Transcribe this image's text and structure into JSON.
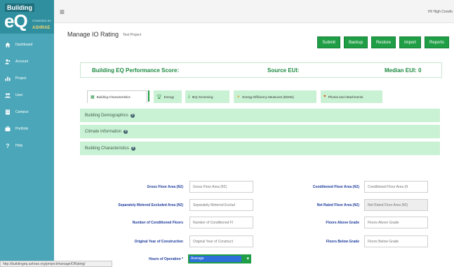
{
  "brand": {
    "top": "Building",
    "eq": "eQ",
    "sub": "POWERED BY",
    "org": "ASHRAE",
    "colors": {
      "sidebar": "#4aa6b8",
      "accent_green": "#1f9e45",
      "section_bg": "#c9f1d3"
    }
  },
  "sidebar": {
    "items": [
      {
        "label": "Dashboard",
        "icon": "home-icon"
      },
      {
        "label": "Account",
        "icon": "account-icon"
      },
      {
        "label": "Project",
        "icon": "bar-chart-icon"
      },
      {
        "label": "User",
        "icon": "users-icon"
      },
      {
        "label": "Campus",
        "icon": "building-icon"
      },
      {
        "label": "Portfolio",
        "icon": "briefcase-icon"
      },
      {
        "label": "Help",
        "icon": "help-icon"
      }
    ]
  },
  "topbar": {
    "greeting": "Hi! High Crowfo"
  },
  "page": {
    "title": "Manage IO Rating",
    "subtitle": "Test Project"
  },
  "toolbar": {
    "buttons": [
      {
        "label": "Submit"
      },
      {
        "label": "Backup"
      },
      {
        "label": "Restore"
      },
      {
        "label": "Import"
      },
      {
        "label": "Reports"
      }
    ]
  },
  "score": {
    "performance_label": "Building EQ Performance Score:",
    "source_eui_label": "Source EUI:",
    "median_eui_label": "Median EUI: 0"
  },
  "tabs": [
    {
      "label": "Building Characteristics",
      "icon": "building-icon"
    },
    {
      "label": "Energy",
      "icon": "trophy-icon"
    },
    {
      "label": "IEQ Screening",
      "icon": "download-icon"
    },
    {
      "label": "Energy Efficiency Measures (EEMs)",
      "icon": "sun-icon"
    },
    {
      "label": "Photos and Attachments",
      "icon": "heart-icon"
    }
  ],
  "sections": [
    {
      "label": "Building Demographics"
    },
    {
      "label": "Climate Information"
    },
    {
      "label": "Building Characteristics"
    }
  ],
  "form": {
    "left": [
      {
        "label": "Gross Floor Area (ft2)",
        "placeholder": "Gross Floor Area (ft2)"
      },
      {
        "label": "Separately Metered Excluded Area (ft2)",
        "placeholder": "Separately Metered Exclud"
      },
      {
        "label": "Number of Conditioned Floors",
        "placeholder": "Number of Conditioned Fl"
      },
      {
        "label": "Original Year of Construction",
        "placeholder": "Original Year of Construct"
      }
    ],
    "right": [
      {
        "label": "Conditioned Floor Area (ft2)",
        "placeholder": "Conditioned Floor Area (ft"
      },
      {
        "label": "Net Rated Floor Area (ft2)",
        "placeholder": "Net Rated Floor Area (ft2)"
      },
      {
        "label": "Floors Above Grade",
        "placeholder": "Floors Above Grade"
      },
      {
        "label": "Floors Below Grade",
        "placeholder": "Floors Below Grade"
      }
    ],
    "hours_label": "Hours of Operation *",
    "hours_value": "Average"
  },
  "statusbar": {
    "url": "http://buildingeq.ashrae.org/project/manageIORating/"
  }
}
